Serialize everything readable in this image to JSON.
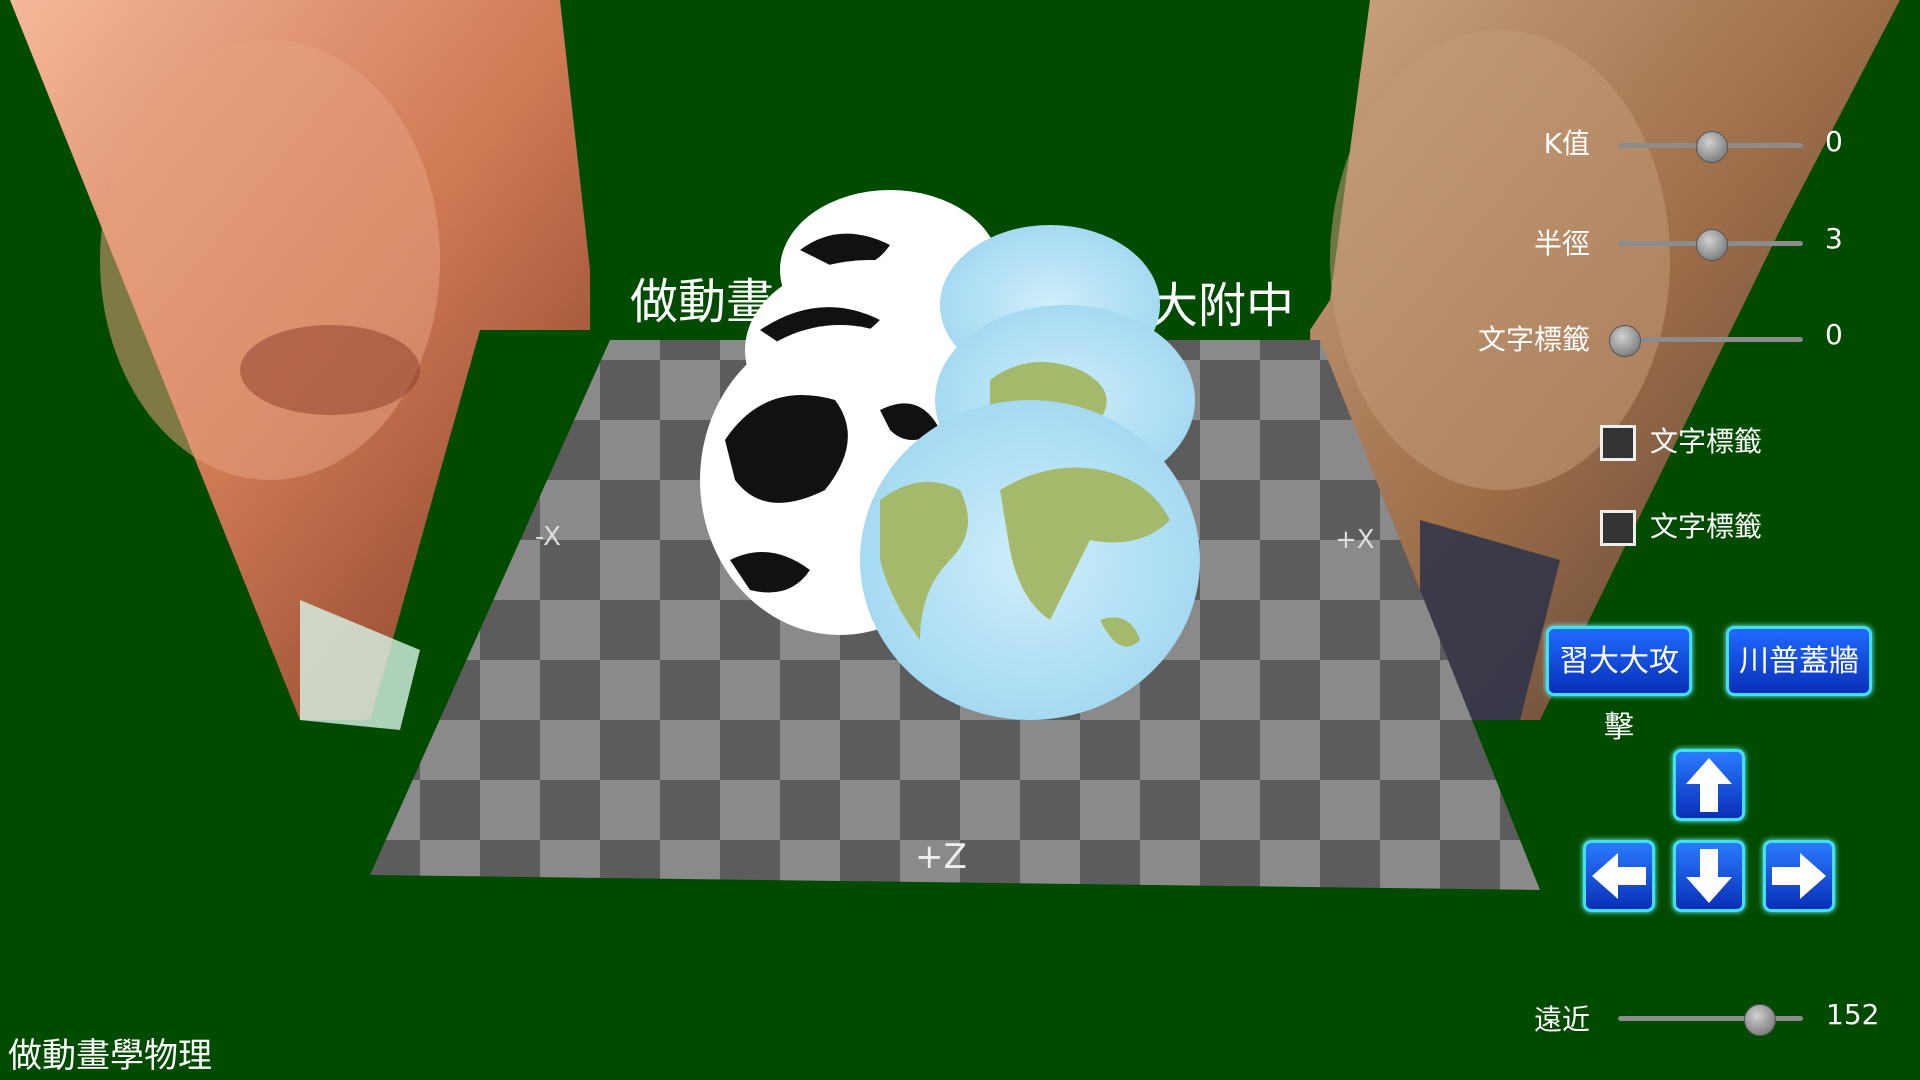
{
  "scene": {
    "banner_left": "做動畫",
    "banner_right": "大附中",
    "axis_neg_x": "-X",
    "axis_pos_x": "+X",
    "axis_pos_z": "+Z"
  },
  "controls": {
    "k_label": "K值",
    "k_value": "0",
    "k_fraction": 0.5,
    "radius_label": "半徑",
    "radius_value": "3",
    "radius_fraction": 0.5,
    "text_tag_label": "文字標籤",
    "text_tag_value": "0",
    "text_tag_fraction": 0,
    "checkbox1_label": "文字標籤",
    "checkbox2_label": "文字標籤",
    "attack_button": "習大大攻擊",
    "wall_button": "川普蓋牆",
    "distance_label": "遠近",
    "distance_value": "152",
    "distance_fraction": 0.76
  },
  "footer": {
    "title": "做動畫學物理"
  },
  "colors": {
    "background": "#004b00",
    "button": "#0a2fb8",
    "button_border": "#40e0ff"
  },
  "icons": [
    "arrow-up-icon",
    "arrow-down-icon",
    "arrow-left-icon",
    "arrow-right-icon"
  ]
}
